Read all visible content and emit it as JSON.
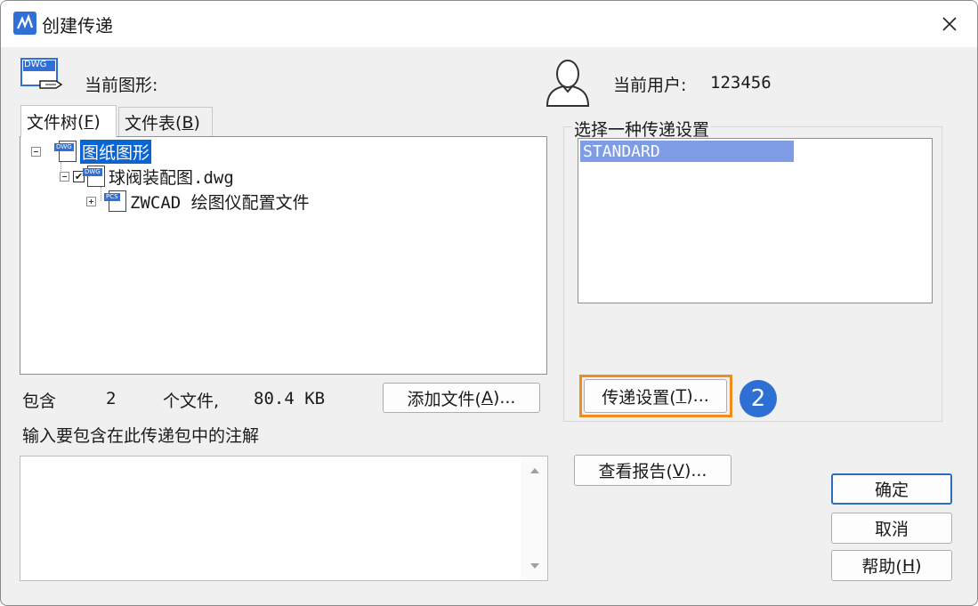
{
  "window": {
    "title": "创建传递"
  },
  "header": {
    "current_drawing_label": "当前图形:",
    "current_user_label": "当前用户:",
    "current_user_value": "123456",
    "dwg_icon_text": "DWG"
  },
  "tabs": [
    {
      "label": "文件树",
      "key": "F"
    },
    {
      "label": "文件表",
      "key": "B"
    }
  ],
  "tree": {
    "root": {
      "label": "图纸图形",
      "icon": "DWG"
    },
    "child": {
      "label": "球阀装配图.dwg",
      "icon": "DWG",
      "checked": true
    },
    "grandchild": {
      "label": "ZWCAD 绘图仪配置文件",
      "icon": "PCS"
    }
  },
  "summary": {
    "prefix": "包含",
    "count": "2",
    "files_text": "个文件,",
    "size": "80.4 KB"
  },
  "buttons": {
    "add_file": {
      "label": "添加文件(",
      "key": "A",
      "suffix": ")..."
    },
    "transmittal_setup": {
      "label": "传递设置(",
      "key": "T",
      "suffix": ")..."
    },
    "view_report": {
      "label": "查看报告(",
      "key": "V",
      "suffix": ")..."
    },
    "ok": "确定",
    "cancel": "取消",
    "help": {
      "label": "帮助(",
      "key": "H",
      "suffix": ")"
    }
  },
  "settings": {
    "group_label": "选择一种传递设置",
    "items": [
      "STANDARD"
    ]
  },
  "notes": {
    "label": "输入要包含在此传递包中的注解",
    "value": ""
  },
  "annotation": {
    "step": "2"
  },
  "colors": {
    "accent": "#0a64d2",
    "highlight": "#f08c1e",
    "badge": "#2d6fd2",
    "list_selected": "#7f9de6"
  }
}
